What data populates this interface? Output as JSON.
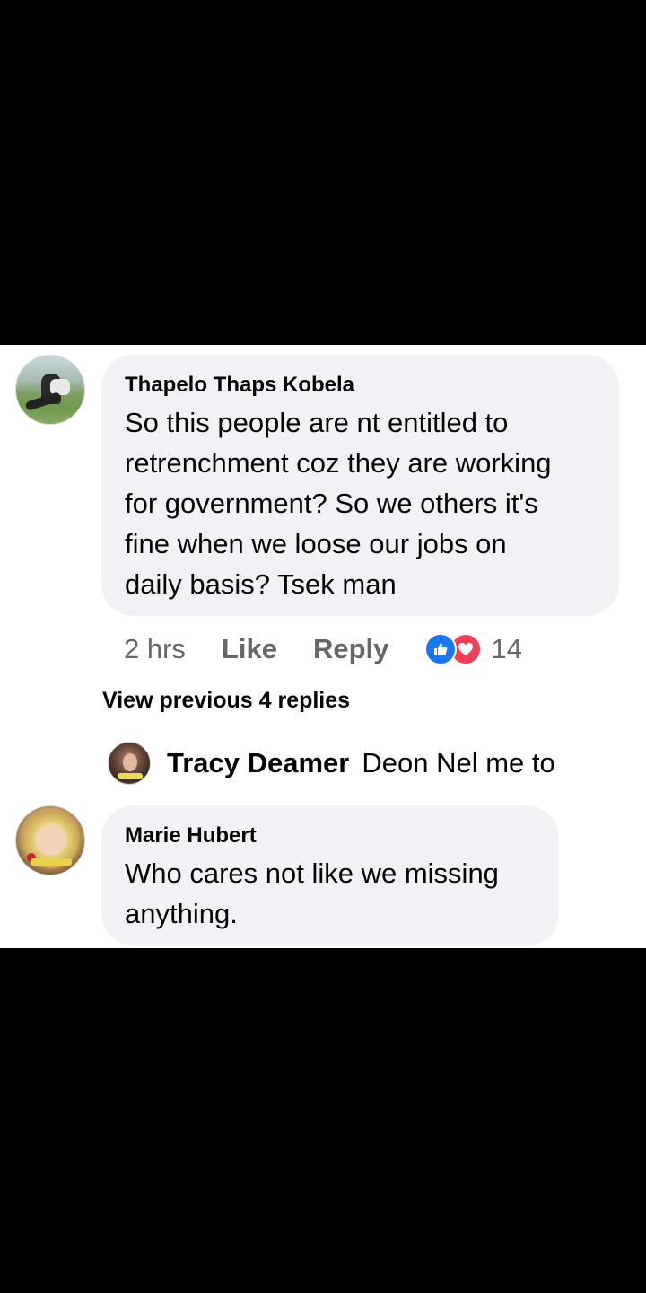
{
  "comments": [
    {
      "author": "Thapelo Thaps Kobela",
      "text_lines": [
        "So this people are nt entitled to",
        "retrenchment coz they are working",
        "for government? So we others it's",
        "fine when we loose our jobs on",
        "daily basis? Tsek man"
      ],
      "time": "2 hrs",
      "like_label": "Like",
      "reply_label": "Reply",
      "reaction_count": "14",
      "reactions": [
        "like-icon",
        "love-icon"
      ],
      "view_previous_replies": "View previous 4 replies",
      "reply_preview": {
        "author": "Tracy Deamer",
        "text": "Deon Nel me to"
      }
    },
    {
      "author": "Marie Hubert",
      "text_lines": [
        "Who cares not like we missing",
        "anything."
      ]
    }
  ],
  "colors": {
    "bubble": "#f0f2f5",
    "secondary_text": "#65676b",
    "primary_text": "#050505",
    "like_blue": "#1877f2",
    "love_red": "#f33e58"
  }
}
